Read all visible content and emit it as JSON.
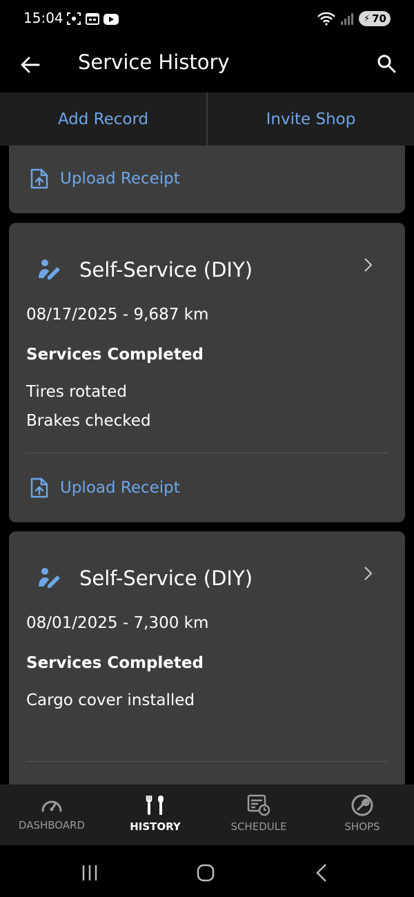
{
  "status_bar": {
    "time": "15:04",
    "battery": "70"
  },
  "app_bar": {
    "title": "Service History"
  },
  "actions": {
    "add_record": "Add Record",
    "invite_shop": "Invite Shop"
  },
  "records": [
    {
      "upload_label": "Upload Receipt"
    },
    {
      "title": "Self-Service (DIY)",
      "meta": "08/17/2025 - 9,687 km",
      "section_title": "Services Completed",
      "services": [
        "Tires rotated",
        "Brakes checked"
      ],
      "upload_label": "Upload Receipt"
    },
    {
      "title": "Self-Service (DIY)",
      "meta": "08/01/2025 - 7,300 km",
      "section_title": "Services Completed",
      "services": [
        "Cargo cover installed"
      ]
    }
  ],
  "bottom_nav": {
    "items": [
      {
        "label": "DASHBOARD",
        "icon": "speedometer-icon",
        "active": false
      },
      {
        "label": "HISTORY",
        "icon": "tools-icon",
        "active": true
      },
      {
        "label": "SCHEDULE",
        "icon": "schedule-icon",
        "active": false
      },
      {
        "label": "SHOPS",
        "icon": "wrench-circle-icon",
        "active": false
      }
    ]
  },
  "colors": {
    "accent": "#6ea6e8",
    "card_bg": "#3d3d3d",
    "bar_bg": "#1e1e1e"
  }
}
